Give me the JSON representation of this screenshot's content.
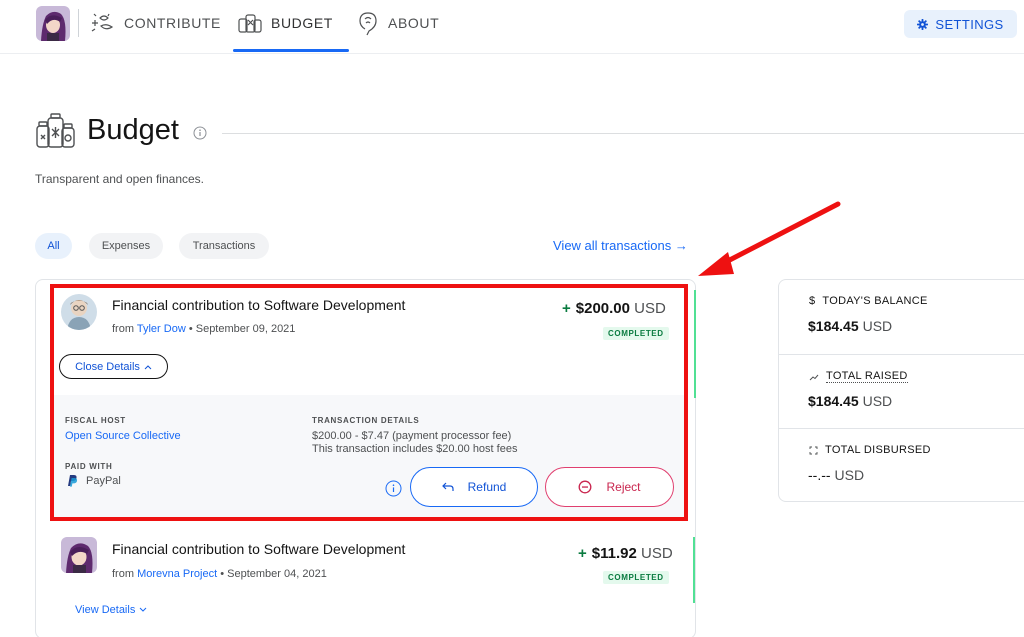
{
  "nav": {
    "items": [
      {
        "label": "CONTRIBUTE",
        "icon": "contribute-icon"
      },
      {
        "label": "BUDGET",
        "icon": "budget-icon",
        "active": true
      },
      {
        "label": "ABOUT",
        "icon": "about-icon"
      }
    ],
    "settings_label": "SETTINGS",
    "settings_icon": "gear-icon"
  },
  "page": {
    "title": "Budget",
    "subtitle": "Transparent and open finances."
  },
  "filters": {
    "items": [
      "All",
      "Expenses",
      "Transactions"
    ],
    "active": "All",
    "view_all_label": "View all transactions →"
  },
  "transactions": [
    {
      "title": "Financial contribution to Software Development",
      "from_prefix": "from",
      "from_name": "Tyler Dow",
      "date": "• September 09, 2021",
      "sign": "+",
      "amount": "$200.00",
      "currency": "USD",
      "status": "COMPLETED",
      "toggle_label": "Close Details",
      "details": {
        "fiscal_host_label": "FISCAL HOST",
        "fiscal_host": "Open Source Collective",
        "paid_with_label": "PAID WITH",
        "paid_with": "PayPal",
        "tx_details_label": "TRANSACTION DETAILS",
        "tx_line1": "$200.00 - $7.47 (payment processor fee)",
        "tx_line2": "This transaction includes $20.00 host fees",
        "refund_label": "Refund",
        "reject_label": "Reject"
      }
    },
    {
      "title": "Financial contribution to Software Development",
      "from_prefix": "from",
      "from_name": "Morevna Project",
      "date": "• September 04, 2021",
      "sign": "+",
      "amount": "$11.92",
      "currency": "USD",
      "status": "COMPLETED",
      "toggle_label": "View Details"
    }
  ],
  "summary": {
    "balance_label": "TODAY'S BALANCE",
    "balance_symbol": "$",
    "balance_value": "$184.45",
    "balance_currency": "USD",
    "raised_label": "TOTAL RAISED",
    "raised_value": "$184.45",
    "raised_currency": "USD",
    "disbursed_label": "TOTAL DISBURSED",
    "disbursed_value": "--.--",
    "disbursed_currency": "USD"
  },
  "colors": {
    "accent": "#1869f5",
    "success": "#0a7b40",
    "danger": "#e03f6f",
    "annotation": "#ee1111"
  }
}
